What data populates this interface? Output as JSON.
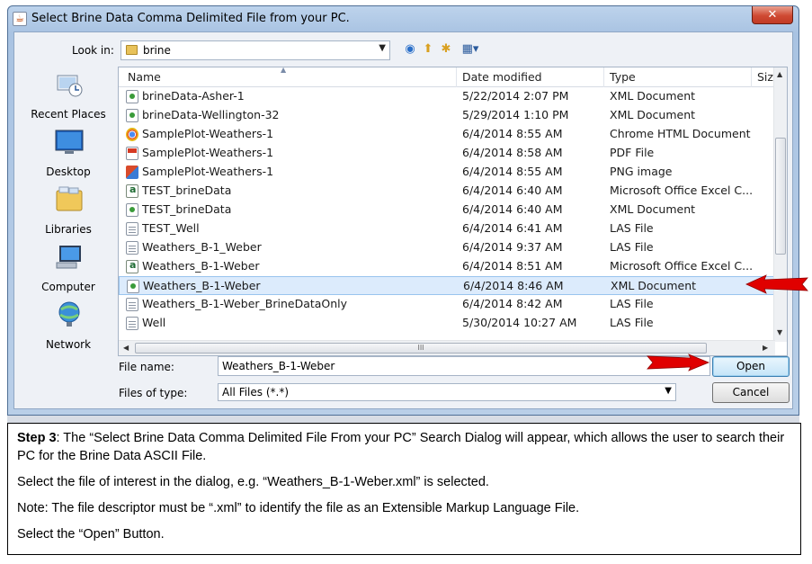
{
  "window": {
    "title": "Select Brine Data Comma Delimited File from your PC.",
    "close_label": "✕"
  },
  "lookin": {
    "label": "Look in:",
    "value": "brine"
  },
  "places": [
    {
      "label": "Recent Places",
      "icon": "recent-places-icon"
    },
    {
      "label": "Desktop",
      "icon": "desktop-icon"
    },
    {
      "label": "Libraries",
      "icon": "libraries-icon"
    },
    {
      "label": "Computer",
      "icon": "computer-icon"
    },
    {
      "label": "Network",
      "icon": "network-icon"
    }
  ],
  "columns": {
    "name": "Name",
    "date": "Date modified",
    "type": "Type",
    "size": "Size"
  },
  "files": [
    {
      "name": "brineData-Asher-1",
      "date": "5/22/2014 2:07 PM",
      "type": "XML Document",
      "icon": "xml"
    },
    {
      "name": "brineData-Wellington-32",
      "date": "5/29/2014 1:10 PM",
      "type": "XML Document",
      "icon": "xml"
    },
    {
      "name": "SamplePlot-Weathers-1",
      "date": "6/4/2014 8:55 AM",
      "type": "Chrome HTML Document",
      "icon": "chrome"
    },
    {
      "name": "SamplePlot-Weathers-1",
      "date": "6/4/2014 8:58 AM",
      "type": "PDF File",
      "icon": "pdf"
    },
    {
      "name": "SamplePlot-Weathers-1",
      "date": "6/4/2014 8:55 AM",
      "type": "PNG image",
      "icon": "png"
    },
    {
      "name": "TEST_brineData",
      "date": "6/4/2014 6:40 AM",
      "type": "Microsoft Office Excel C...",
      "icon": "excel"
    },
    {
      "name": "TEST_brineData",
      "date": "6/4/2014 6:40 AM",
      "type": "XML Document",
      "icon": "xml"
    },
    {
      "name": "TEST_Well",
      "date": "6/4/2014 6:41 AM",
      "type": "LAS File",
      "icon": "las"
    },
    {
      "name": "Weathers_B-1_Weber",
      "date": "6/4/2014 9:37 AM",
      "type": "LAS File",
      "icon": "las"
    },
    {
      "name": "Weathers_B-1-Weber",
      "date": "6/4/2014 8:51 AM",
      "type": "Microsoft Office Excel C...",
      "icon": "excel"
    },
    {
      "name": "Weathers_B-1-Weber",
      "date": "6/4/2014 8:46 AM",
      "type": "XML Document",
      "icon": "xml",
      "selected": true
    },
    {
      "name": "Weathers_B-1-Weber_BrineDataOnly",
      "date": "6/4/2014 8:42 AM",
      "type": "LAS File",
      "icon": "las"
    },
    {
      "name": "Well",
      "date": "5/30/2014 10:27 AM",
      "type": "LAS File",
      "icon": "las"
    }
  ],
  "scrollbar": {
    "hthumb_grip": "III"
  },
  "filename": {
    "label": "File name:",
    "value": "Weathers_B-1-Weber"
  },
  "filetype": {
    "label": "Files of type:",
    "value": "All Files (*.*)"
  },
  "buttons": {
    "open": "Open",
    "cancel": "Cancel"
  },
  "colors": {
    "selection": "#dcebfc",
    "arrow_red": "#e00000"
  },
  "caption": {
    "step_label": "Step 3",
    "step_text": ": The “Select Brine Data Comma Delimited File From your PC” Search Dialog will appear, which allows the user to search their PC for the Brine Data ASCII File.",
    "line2": "Select the file of interest in the dialog, e.g. “Weathers_B-1-Weber.xml”  is selected.",
    "line3": "Note: The file descriptor must be “.xml” to identify the file as an Extensible Markup Language File.",
    "line4": "Select the “Open” Button."
  }
}
